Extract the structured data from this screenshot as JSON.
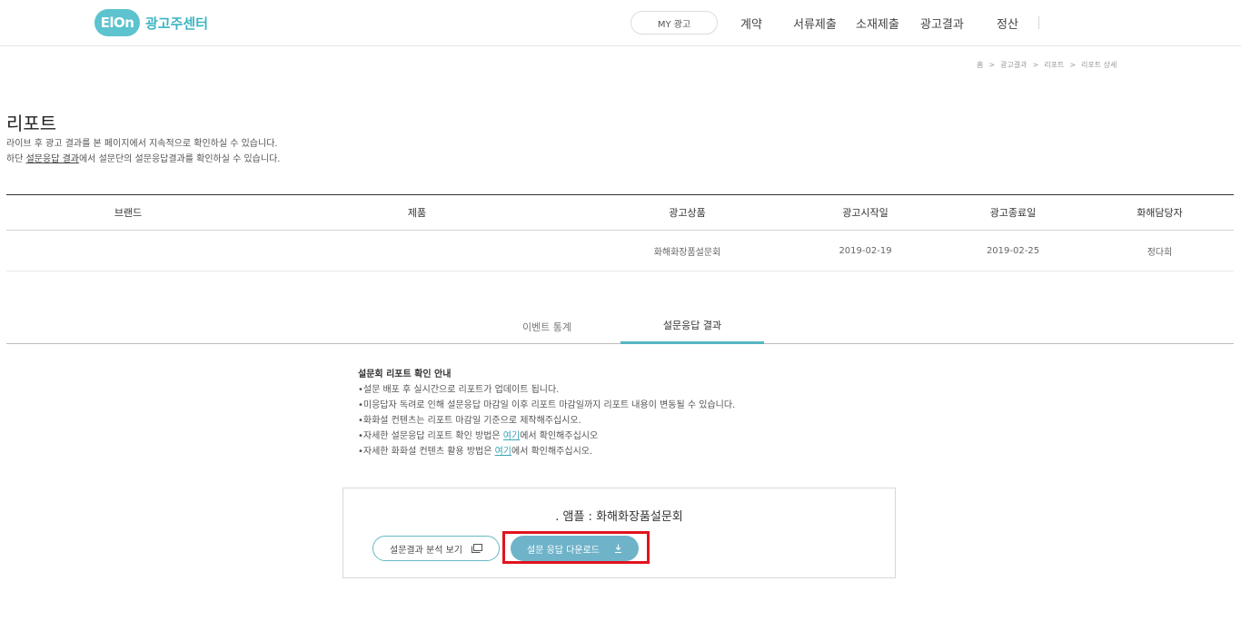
{
  "header": {
    "logo_mark": "ElOn",
    "logo_text": "광고주센터",
    "my_ad_label": "MY 광고",
    "nav_items": [
      "계약",
      "서류제출",
      "소재제출",
      "광고결과",
      "정산"
    ]
  },
  "breadcrumb": [
    "홈",
    "광고결과",
    "리포트",
    "리포트 상세"
  ],
  "page": {
    "title": "리포트",
    "desc_line1": "라이브 후 광고 결과를 본 페이지에서 지속적으로 확인하실 수 있습니다.",
    "desc_line2_prefix": "하단 ",
    "desc_line2_link": "설문응답 결과",
    "desc_line2_suffix": "에서 설문단의 설문응답결과를 확인하실 수 있습니다."
  },
  "table": {
    "headers": [
      "브랜드",
      "제품",
      "광고상품",
      "광고시작일",
      "광고종료일",
      "화해담당자"
    ],
    "row": [
      "",
      "",
      "화해화장품설문회",
      "2019-02-19",
      "2019-02-25",
      "정다희"
    ]
  },
  "tabs": [
    "이벤트 통계",
    "설문응답 결과"
  ],
  "notice": {
    "title": "설문회 리포트 확인 안내",
    "line1": "•설문 배포 후 실시간으로 리포트가 업데이트 됩니다.",
    "line2": "•미응답자 독려로 인해 설문응답 마감일 이후 리포트 마감일까지 리포트 내용이 변동될 수 있습니다.",
    "line3": "•화화설 컨텐츠는 리포트 마감일 기준으로 제작해주십시오.",
    "line4_prefix": "•자세한 설문응답 리포트 확인 방법은 ",
    "line4_link": "여기",
    "line4_suffix": "에서 확인해주십시오",
    "line5_prefix": "•자세한 화화설 컨텐츠 활용 방법은 ",
    "line5_link": "여기",
    "line5_suffix": "에서 확인해주십시오."
  },
  "survey": {
    "title": ". 앰플 : 화해화장품설문회",
    "analysis_label": "설문결과 분석 보기",
    "download_label": "설문 응답 다운로드"
  },
  "colors": {
    "accent": "#55b6c2",
    "button_fill": "#6fb3c9",
    "highlight": "#e0141e"
  }
}
